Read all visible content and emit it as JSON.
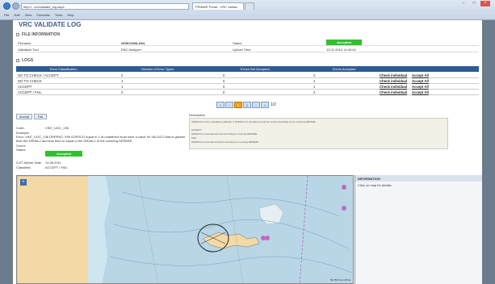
{
  "browser": {
    "address": "http://...vrc/validate_log.aspx",
    "tabs": [
      "PRIMAR Portal - VRC Valida...",
      ""
    ],
    "menu": [
      "File",
      "Edit",
      "View",
      "Favorites",
      "Tools",
      "Help"
    ]
  },
  "page": {
    "title": "VRC VALIDATE LOG"
  },
  "file_info": {
    "header": "FILE INFORMATION",
    "filename_label": "Filename",
    "filename_value": "NO5C255A.ANL",
    "status_label": "Status",
    "status_value": "Accepted",
    "validation_tool_label": "Validation Tool",
    "validation_tool_value": "ENC Analyzer",
    "upload_time_label": "Upload Time",
    "upload_time_value": "13.01.2014 14:49:04",
    "status_color": "#2fc12f"
  },
  "logs": {
    "header": "LOGS",
    "columns": [
      "Error Classification",
      "Number of Error Types",
      "Errors Not Accepted",
      "Errors Accepted"
    ],
    "rows": [
      {
        "classification": "NO TO CHECK / ACCEPT",
        "types": "2",
        "not_accepted": "0",
        "accepted": "2",
        "check": "Check individual",
        "accept": "Accept All"
      },
      {
        "classification": "NO TO CHECK",
        "types": "1",
        "not_accepted": "0",
        "accepted": "1",
        "check": "Check individual",
        "accept": "Accept All"
      },
      {
        "classification": "ACCEPT",
        "types": "1",
        "not_accepted": "0",
        "accepted": "1",
        "check": "Check individual",
        "accept": "Accept All"
      },
      {
        "classification": "ACCEPT / FAIL",
        "types": "2",
        "not_accepted": "0",
        "accepted": "2",
        "check": "Check individual",
        "accept": "Accept All"
      }
    ],
    "header_color": "#2f5b93"
  },
  "pager": {
    "pages": [
      "1",
      "2"
    ],
    "active": "1",
    "summary": "1/2"
  },
  "detail": {
    "accept_button": "Accept",
    "fail_button": "Fail",
    "code_label": "Code:",
    "code_value": "VIN7_UOC_136",
    "example_label": "Example:",
    "example_text": "Error: VIN7_UOC_136 DRPRSC: 599 SOFRCO equal to 1 at undefined must have a value for VALDCO that is greater",
    "example_text2": "than the DRVAL2 and less than or equal to the DRVAL2 of the covering DEPARE.",
    "count_label": "Count:",
    "status_label": "Status:",
    "status_value": "Accepted",
    "advise_date_label": "S-57 Advise Date:",
    "advise_date_value": "10.06.2011",
    "classified_label": "Classified:",
    "classified_value": "ACCEPT / FAIL",
    "description_label": "Description",
    "description_lines": [
      "SOFRCO is not a mandatory attribute. If SOFRCO is encoded it must be correct according to the covering DEPARE.",
      "",
      "ACCEPT:",
      "SOFRCO is encoded and set according to covering DEPARE.",
      "FAIL:",
      "SOFRCO is encoded incorrect according to covering DEPARE."
    ]
  },
  "info_panel": {
    "title": "INFORMATION",
    "hint": "Click on map for details"
  },
  "map": {
    "zoom_label": "+",
    "coords": "59.786 N 10.472 E"
  }
}
